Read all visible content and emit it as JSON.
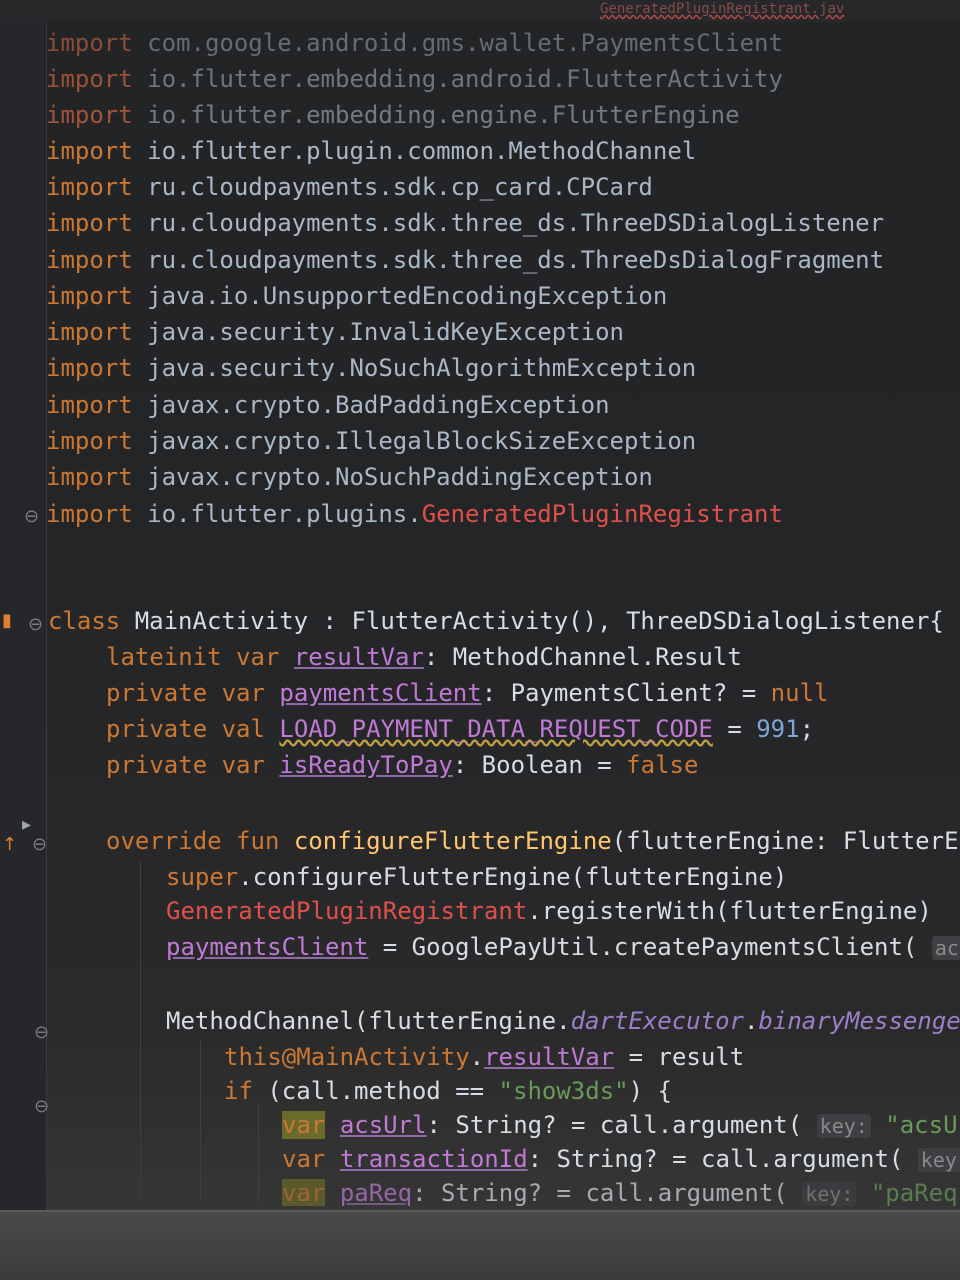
{
  "editor": {
    "tabs": {
      "left": "",
      "middle": "",
      "right": "GeneratedPluginRegistrant.jav"
    }
  },
  "code": {
    "imports": [
      {
        "kw": "import",
        "pkg": "com.google.android.gms.wallet.PaymentsClient"
      },
      {
        "kw": "import",
        "pkg": "io.flutter.embedding.android.FlutterActivity"
      },
      {
        "kw": "import",
        "pkg": "io.flutter.embedding.engine.FlutterEngine"
      },
      {
        "kw": "import",
        "pkg": "io.flutter.plugin.common.MethodChannel"
      },
      {
        "kw": "import",
        "pkg": "ru.cloudpayments.sdk.cp_card.CPCard"
      },
      {
        "kw": "import",
        "pkg": "ru.cloudpayments.sdk.three_ds.ThreeDSDialogListener"
      },
      {
        "kw": "import",
        "pkg": "ru.cloudpayments.sdk.three_ds.ThreeDsDialogFragment"
      },
      {
        "kw": "import",
        "pkg": "java.io.UnsupportedEncodingException"
      },
      {
        "kw": "import",
        "pkg": "java.security.InvalidKeyException"
      },
      {
        "kw": "import",
        "pkg": "java.security.NoSuchAlgorithmException"
      },
      {
        "kw": "import",
        "pkg": "javax.crypto.BadPaddingException"
      },
      {
        "kw": "import",
        "pkg": "javax.crypto.IllegalBlockSizeException"
      },
      {
        "kw": "import",
        "pkg": "javax.crypto.NoSuchPaddingException"
      }
    ],
    "last_import": {
      "kw": "import",
      "pkg": "io.flutter.plugins.",
      "cls": "GeneratedPluginRegistrant"
    },
    "class_line": {
      "kw": "class",
      "name": " MainActivity : FlutterActivity(), ThreeDSDialogListener{"
    },
    "fields": [
      {
        "mod": "lateinit var ",
        "name": "resultVar",
        "rest": ": MethodChannel.Result"
      },
      {
        "mod": "private var ",
        "name": "paymentsClient",
        "rest": ": PaymentsClient? = ",
        "lit": "null"
      },
      {
        "mod": "private val ",
        "name": "LOAD_PAYMENT_DATA_REQUEST_CODE",
        "rest": " = ",
        "num": "991",
        "end": ";"
      },
      {
        "mod": "private var ",
        "name": "isReadyToPay",
        "rest": ": Boolean = ",
        "lit": "false"
      }
    ],
    "override_line": {
      "kw": "override fun ",
      "fn": "configureFlutterEngine",
      "rest": "(flutterEngine: FlutterEng"
    },
    "super_line": {
      "kw": "super",
      "rest": ".configureFlutterEngine(flutterEngine)"
    },
    "registrant_line": {
      "cls": "GeneratedPluginRegistrant",
      "rest": ".registerWith(flutterEngine)"
    },
    "payments_line": {
      "name": "paymentsClient",
      "rest": " = GooglePayUtil.createPaymentsClient( ",
      "hint": "activi"
    },
    "channel_line": {
      "start": "MethodChannel(flutterEngine.",
      "prop": "dartExecutor",
      "dot": ".",
      "prop2": "binaryMessenger",
      "end": ","
    },
    "this_line": {
      "kw": "this@MainActivity",
      "dot": ".",
      "name": "resultVar",
      "rest": " = result"
    },
    "if_line": {
      "kw": "if",
      "rest": " (call.method == ",
      "str": "\"show3ds\"",
      "end": ") {"
    },
    "acs_line": {
      "kw": "var",
      "name": "acsUrl",
      "rest": ": String? = call.argument( ",
      "hint": "key:",
      "str": " \"acsUrl\""
    },
    "tx_line": {
      "kw": "var",
      "name": "transactionId",
      "rest": ": String? = call.argument( ",
      "hint": "key:",
      "str": " \""
    },
    "pareq_line": {
      "kw": "var",
      "name": "paReq",
      "rest": ": String? = call.argument( ",
      "hint": "key:",
      "str": " \"paReq\")"
    }
  }
}
